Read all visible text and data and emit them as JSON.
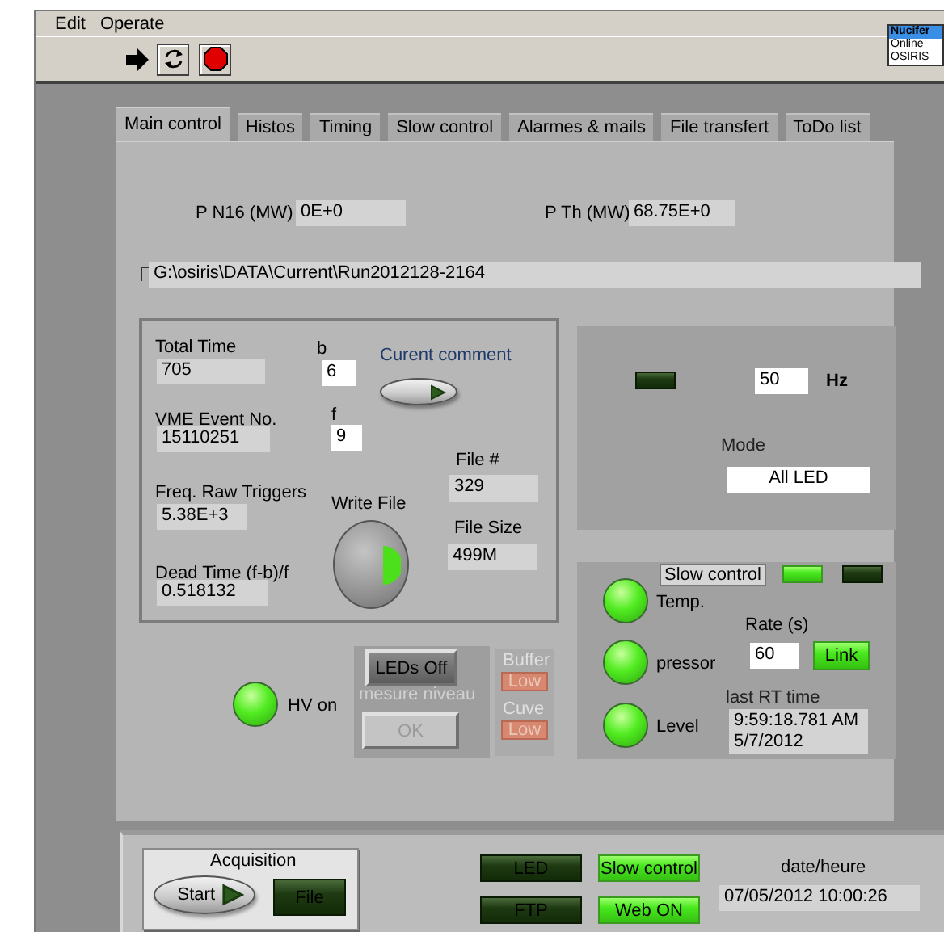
{
  "menu": [
    "Edit",
    "Operate"
  ],
  "instances": [
    {
      "label": "Nucifer",
      "selected": true
    },
    {
      "label": "Online",
      "selected": false
    },
    {
      "label": "OSIRIS",
      "selected": false
    }
  ],
  "tabs": [
    {
      "label": "Main control",
      "selected": true
    },
    {
      "label": "Histos",
      "selected": false
    },
    {
      "label": "Timing",
      "selected": false
    },
    {
      "label": "Slow control",
      "selected": false
    },
    {
      "label": "Alarmes & mails",
      "selected": false
    },
    {
      "label": "File transfert",
      "selected": false
    },
    {
      "label": "ToDo list",
      "selected": false
    }
  ],
  "power": [
    {
      "label": "P N16 (MW)",
      "value": "0E+0"
    },
    {
      "label": "P Th (MW)",
      "value": "68.75E+0"
    }
  ],
  "path": "G:\\osiris\\DATA\\Current\\Run2012128-2164",
  "run_stats": [
    {
      "label": "Total Time",
      "value": "705"
    },
    {
      "label": "VME Event No.",
      "value": "15110251"
    },
    {
      "label": "Freq. Raw Triggers",
      "value": "5.38E+3"
    },
    {
      "label": "Dead Time (f-b)/f",
      "value": "0.518132"
    }
  ],
  "b": {
    "label": "b",
    "value": "6"
  },
  "f": {
    "label": "f",
    "value": "9"
  },
  "comment_button": {
    "label": "Curent comment",
    "on": false
  },
  "write_file": {
    "label": "Write File",
    "on": true
  },
  "file_number": {
    "label": "File #",
    "value": "329"
  },
  "file_size": {
    "label": "File Size",
    "value": "499M"
  },
  "led_pulser": {
    "on": false,
    "frequency": "50",
    "unit": "Hz",
    "mode_label": "Mode",
    "mode": "All LED"
  },
  "slow_control": {
    "title": "Slow control",
    "indicators": [
      {
        "on": true
      },
      {
        "on": false
      }
    ],
    "sensors": [
      {
        "label": "Temp.",
        "on": true
      },
      {
        "label": "pressor",
        "on": true
      },
      {
        "label": "Level",
        "on": true
      }
    ],
    "rate_label": "Rate (s)",
    "rate": "60",
    "link": {
      "label": "Link",
      "on": true
    },
    "last_rt_label": "last RT time",
    "last_rt": "9:59:18.781 AM\n5/7/2012"
  },
  "hv": {
    "label": "HV on",
    "on": true
  },
  "leds_off": {
    "label": "LEDs Off"
  },
  "level_measure": {
    "label": "mesure niveau",
    "disabled": true,
    "button": "OK"
  },
  "levels": [
    {
      "label": "Buffer",
      "value": "Low"
    },
    {
      "label": "Cuve",
      "value": "Low"
    }
  ],
  "acquisition": {
    "label": "Acquisition",
    "start": {
      "label": "Start",
      "on": false
    },
    "file": {
      "label": "File",
      "on": false
    }
  },
  "status": [
    {
      "label": "LED",
      "on": false
    },
    {
      "label": "Slow control",
      "on": true
    },
    {
      "label": "FTP",
      "on": false
    },
    {
      "label": "Web ON",
      "on": true
    }
  ],
  "date": {
    "label": "date/heure",
    "value": "07/05/2012 10:00:26"
  }
}
